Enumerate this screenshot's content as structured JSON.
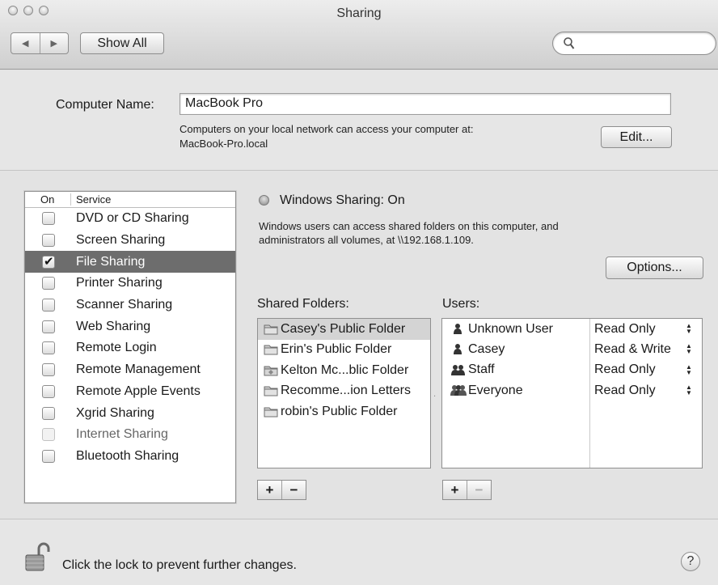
{
  "window": {
    "title": "Sharing"
  },
  "toolbar": {
    "back_icon": "back-arrow-icon",
    "forward_icon": "forward-arrow-icon",
    "show_all_label": "Show All",
    "search_value": "",
    "search_icon": "search-icon"
  },
  "computer_name": {
    "label": "Computer Name:",
    "value": "MacBook Pro",
    "desc_line1": "Computers on your local network can access your computer at:",
    "desc_line2": "MacBook-Pro.local",
    "edit_label": "Edit..."
  },
  "services": {
    "header_on": "On",
    "header_service": "Service",
    "items": [
      {
        "label": "DVD or CD Sharing",
        "checked": false,
        "selected": false,
        "disabled": false
      },
      {
        "label": "Screen Sharing",
        "checked": false,
        "selected": false,
        "disabled": false
      },
      {
        "label": "File Sharing",
        "checked": true,
        "selected": true,
        "disabled": false
      },
      {
        "label": "Printer Sharing",
        "checked": false,
        "selected": false,
        "disabled": false
      },
      {
        "label": "Scanner Sharing",
        "checked": false,
        "selected": false,
        "disabled": false
      },
      {
        "label": "Web Sharing",
        "checked": false,
        "selected": false,
        "disabled": false
      },
      {
        "label": "Remote Login",
        "checked": false,
        "selected": false,
        "disabled": false
      },
      {
        "label": "Remote Management",
        "checked": false,
        "selected": false,
        "disabled": false
      },
      {
        "label": "Remote Apple Events",
        "checked": false,
        "selected": false,
        "disabled": false
      },
      {
        "label": "Xgrid Sharing",
        "checked": false,
        "selected": false,
        "disabled": false
      },
      {
        "label": "Internet Sharing",
        "checked": false,
        "selected": false,
        "disabled": true
      },
      {
        "label": "Bluetooth Sharing",
        "checked": false,
        "selected": false,
        "disabled": false
      }
    ]
  },
  "status": {
    "title": "Windows Sharing: On",
    "desc_line1": "Windows users can access shared folders on this computer, and",
    "desc_line2": "administrators all volumes, at \\\\192.168.1.109.",
    "options_label": "Options..."
  },
  "shared_folders": {
    "label": "Shared Folders:",
    "items": [
      {
        "name": "Casey's Public Folder",
        "selected": true,
        "icon": "folder-icon"
      },
      {
        "name": "Erin's Public Folder",
        "selected": false,
        "icon": "folder-icon"
      },
      {
        "name": "Kelton Mc...blic Folder",
        "selected": false,
        "icon": "public-folder-icon"
      },
      {
        "name": "Recomme...ion Letters",
        "selected": false,
        "icon": "folder-icon"
      },
      {
        "name": "robin's Public Folder",
        "selected": false,
        "icon": "folder-icon"
      }
    ],
    "add_label": "+",
    "remove_label": "−"
  },
  "users": {
    "label": "Users:",
    "items": [
      {
        "name": "Unknown User",
        "permission": "Read Only",
        "icon": "user-icon"
      },
      {
        "name": "Casey",
        "permission": "Read & Write",
        "icon": "user-icon"
      },
      {
        "name": "Staff",
        "permission": "Read Only",
        "icon": "group-icon"
      },
      {
        "name": "Everyone",
        "permission": "Read Only",
        "icon": "everyone-icon"
      }
    ],
    "add_label": "+",
    "remove_label": "−"
  },
  "footer": {
    "lock_text": "Click the lock to prevent further changes.",
    "help_label": "?"
  }
}
